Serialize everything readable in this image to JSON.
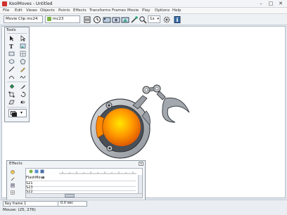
{
  "window": {
    "title": "KoolMoves - Untitled"
  },
  "menu": [
    "File",
    "Edit",
    "Views",
    "Objects",
    "Points",
    "Effects",
    "Transforms",
    "Frames",
    "Movie",
    "Play",
    "Options",
    "Help"
  ],
  "toolbar": {
    "movie_clip_select": "Movie Clip mc24",
    "clip_label": "mc23",
    "zoom_value": "1x"
  },
  "tools_panel": {
    "title": "Tools"
  },
  "effects_panel": {
    "title": "Effects",
    "close_glyph": "x",
    "layers": [
      {
        "name": "FlashMove"
      },
      {
        "name": "S21"
      },
      {
        "name": "S23"
      },
      {
        "name": "S22"
      }
    ]
  },
  "status": {
    "frame_label": "Key frame 1",
    "time_label": "0.0 sec",
    "mouse_label": "Mouse: (25, 276)"
  },
  "colors": {
    "accent_orange": "#ff8a00",
    "robot_gray": "#9a9fa5",
    "robot_dark": "#4a4f56",
    "window_bg": "#dfe6ee"
  }
}
